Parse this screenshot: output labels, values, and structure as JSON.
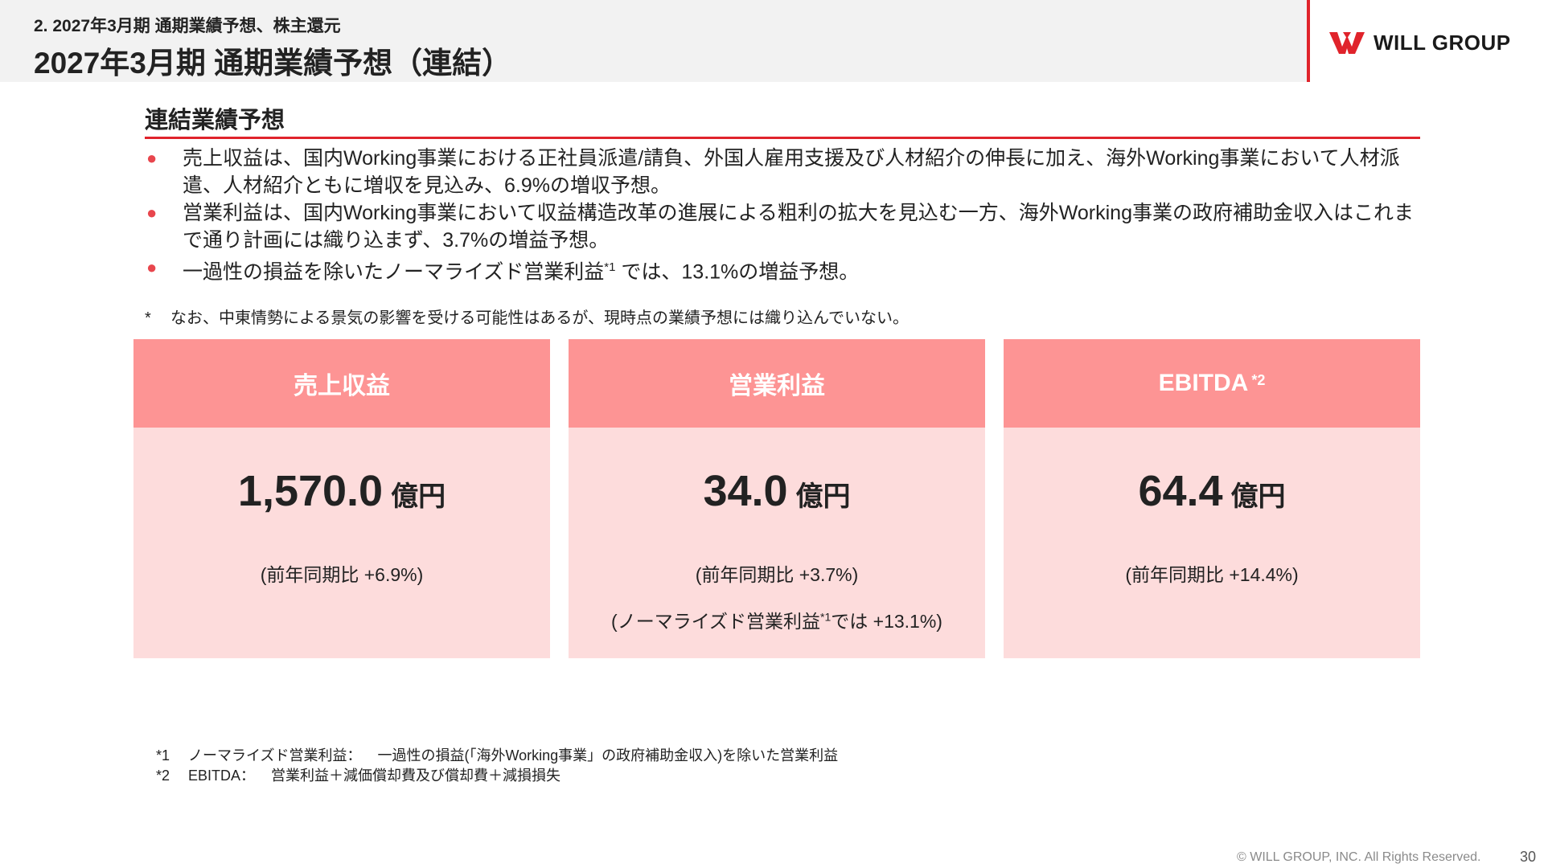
{
  "header": {
    "section_label": "2. 2027年3月期 通期業績予想、株主還元",
    "title": "2027年3月期 通期業績予想（連結）"
  },
  "logo": {
    "icon": "will-group-w-logo",
    "text": "WILL GROUP",
    "color": "#e0232b"
  },
  "subheading": "連結業績予想",
  "bullets": [
    "売上収益は、国内Working事業における正社員派遣/請負、外国人雇用支援及び人材紹介の伸長に加え、海外Working事業において人材派遣、人材紹介ともに増収を見込み、6.9%の増収予想。",
    "営業利益は、国内Working事業において収益構造改革の進展による粗利の拡大を見込む一方、海外Working事業の政府補助金収入はこれまで通り計画には織り込まず、3.7%の増益予想。",
    "一過性の損益を除いたノーマライズド営業利益"
  ],
  "bullet3_sup": "*1",
  "bullet3_tail": " では、13.1%の増益予想。",
  "note": {
    "mark": "*",
    "text": "なお、中東情勢による景気の影響を受ける可能性はあるが、現時点の業績予想には織り込んでいない。"
  },
  "cards": [
    {
      "label": "売上収益",
      "label_sup": "",
      "value": "1,570.0",
      "unit": "億円",
      "yoy": "(前年同期比 +6.9%)",
      "extra_pre": "",
      "extra_sup": "",
      "extra_post": ""
    },
    {
      "label": "営業利益",
      "label_sup": "",
      "value": "34.0",
      "unit": "億円",
      "yoy": "(前年同期比 +3.7%)",
      "extra_pre": "(ノーマライズド営業利益",
      "extra_sup": "*1",
      "extra_post": "では +13.1%)"
    },
    {
      "label": "EBITDA",
      "label_sup": "*2",
      "value": "64.4",
      "unit": "億円",
      "yoy": "(前年同期比 +14.4%)",
      "extra_pre": "",
      "extra_sup": "",
      "extra_post": ""
    }
  ],
  "footnotes": [
    {
      "key": "*1",
      "term": "ノーマライズド営業利益：",
      "desc": "一過性の損益(「海外Working事業」の政府補助金収入)を除いた営業利益"
    },
    {
      "key": "*2",
      "term": "EBITDA：",
      "desc": "営業利益＋減価償却費及び償却費＋減損損失"
    }
  ],
  "copyright": "© WILL GROUP, INC. All Rights Reserved.",
  "page_number": "30"
}
